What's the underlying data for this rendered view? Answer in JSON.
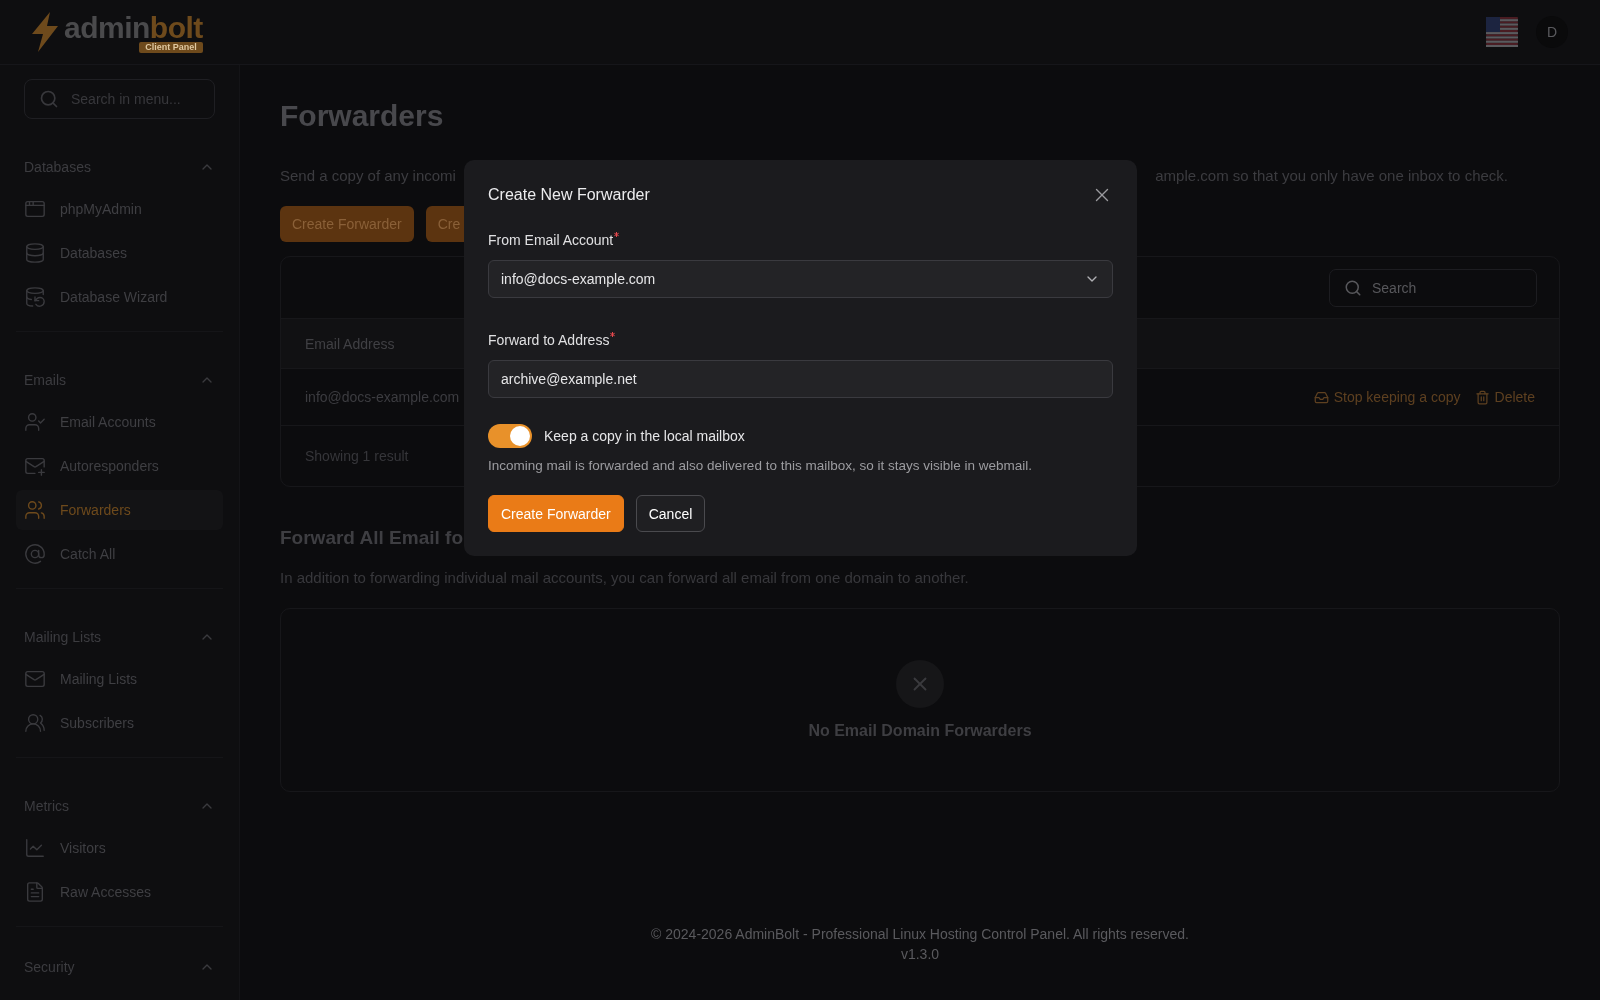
{
  "header": {
    "logo": {
      "left": "admin",
      "right": "bolt",
      "badge": "Client Panel"
    },
    "avatar": "D"
  },
  "sidebar": {
    "search": {
      "placeholder": "Search in menu..."
    },
    "sections": [
      {
        "title": "Databases",
        "expanded": true,
        "items": [
          {
            "label": "phpMyAdmin",
            "selected": false
          },
          {
            "label": "Databases",
            "selected": false
          },
          {
            "label": "Database Wizard",
            "selected": false
          }
        ]
      },
      {
        "title": "Emails",
        "expanded": true,
        "items": [
          {
            "label": "Email Accounts",
            "selected": false
          },
          {
            "label": "Autoresponders",
            "selected": false
          },
          {
            "label": "Forwarders",
            "selected": true
          },
          {
            "label": "Catch All",
            "selected": false
          }
        ]
      },
      {
        "title": "Mailing Lists",
        "expanded": true,
        "items": [
          {
            "label": "Mailing Lists",
            "selected": false
          },
          {
            "label": "Subscribers",
            "selected": false
          }
        ]
      },
      {
        "title": "Metrics",
        "expanded": true,
        "items": [
          {
            "label": "Visitors",
            "selected": false
          },
          {
            "label": "Raw Accesses",
            "selected": false
          }
        ]
      },
      {
        "title": "Security",
        "expanded": true
      }
    ]
  },
  "page": {
    "title": "Forwarders",
    "description_parts": [
      "Send a copy of any incomi",
      "ample.com so that you only have one inbox to check."
    ],
    "buttons": [
      "Create Forwarder",
      "Cre"
    ],
    "table": {
      "search": {
        "placeholder": "Search"
      },
      "columns": [
        "Email Address"
      ],
      "rows": [
        {
          "email": "info@docs-example.com",
          "actions": [
            {
              "label": "Stop keeping a copy",
              "kind": "stop-copy"
            },
            {
              "label": "Delete",
              "kind": "delete"
            }
          ]
        }
      ],
      "footer": "Showing 1 result"
    },
    "domain_section": {
      "title": "Forward All Email fo",
      "description": "In addition to forwarding individual mail accounts, you can forward all email from one domain to another.",
      "empty_text": "No Email Domain Forwarders"
    },
    "footer": {
      "copyright": "© 2024-2026 AdminBolt - Professional Linux Hosting Control Panel. All rights reserved.",
      "version": "v1.3.0"
    }
  },
  "modal": {
    "title": "Create New Forwarder",
    "fields": [
      {
        "label": "From Email Account",
        "required": true,
        "kind": "select",
        "value": "info@docs-example.com"
      },
      {
        "label": "Forward to Address",
        "required": true,
        "kind": "input",
        "value": "archive@example.net"
      }
    ],
    "toggle": {
      "label": "Keep a copy in the local mailbox",
      "on": true,
      "help": "Incoming mail is forwarded and also delivered to this mailbox, so it stays visible in webmail."
    },
    "buttons": [
      {
        "label": "Create Forwarder",
        "kind": "primary"
      },
      {
        "label": "Cancel",
        "kind": "secondary"
      }
    ]
  }
}
